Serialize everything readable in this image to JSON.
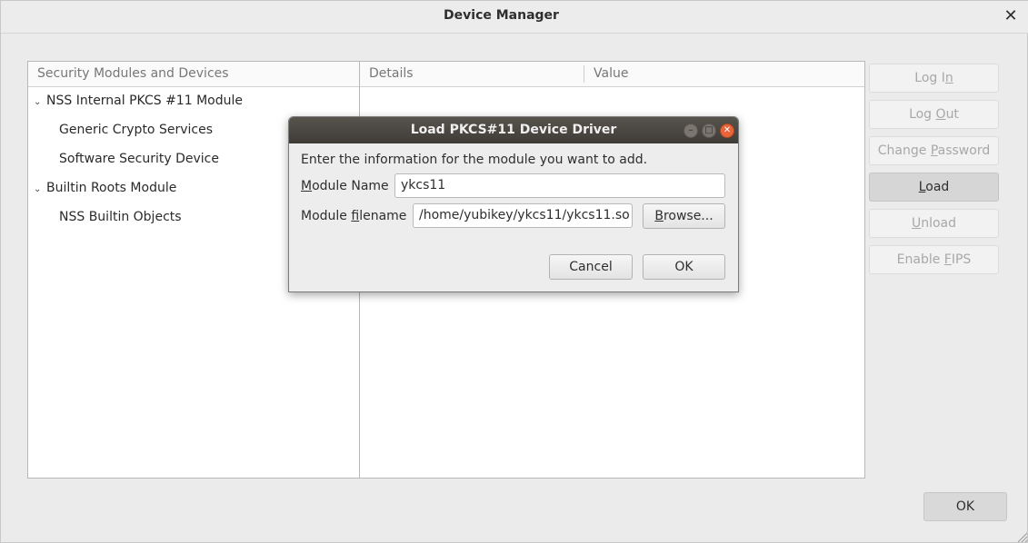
{
  "window": {
    "title": "Device Manager",
    "close_glyph": "✕",
    "ok_label": "OK"
  },
  "tree": {
    "header": "Security Modules and Devices",
    "items": [
      {
        "label": "NSS Internal PKCS #11 Module",
        "expanded": true,
        "level": 0
      },
      {
        "label": "Generic Crypto Services",
        "level": 1
      },
      {
        "label": "Software Security Device",
        "level": 1
      },
      {
        "label": "Builtin Roots Module",
        "expanded": true,
        "level": 0
      },
      {
        "label": "NSS Builtin Objects",
        "level": 1
      }
    ],
    "twisty_glyph": "⌄"
  },
  "details": {
    "col_details": "Details",
    "col_value": "Value"
  },
  "side_buttons": [
    {
      "label": "Log In",
      "enabled": false
    },
    {
      "label": "Log Out",
      "enabled": false
    },
    {
      "label": "Change Password",
      "enabled": false
    },
    {
      "label": "Load",
      "enabled": true
    },
    {
      "label": "Unload",
      "enabled": false
    },
    {
      "label": "Enable FIPS",
      "enabled": false
    }
  ],
  "dialog": {
    "title": "Load PKCS#11 Device Driver",
    "intro": "Enter the information for the module you want to add.",
    "module_name_label": "Module Name",
    "module_name_value": "ykcs11",
    "module_filename_label": "Module filename",
    "module_filename_value": "/home/yubikey/ykcs11/ykcs11.so",
    "browse_label": "Browse...",
    "cancel_label": "Cancel",
    "ok_label": "OK",
    "min_glyph": "–",
    "max_glyph": "□",
    "close_glyph": "✕"
  },
  "colors": {
    "dialog_titlebar": "#4a4742",
    "close_button": "#e8643a",
    "active_button": "#d6d6d6"
  }
}
